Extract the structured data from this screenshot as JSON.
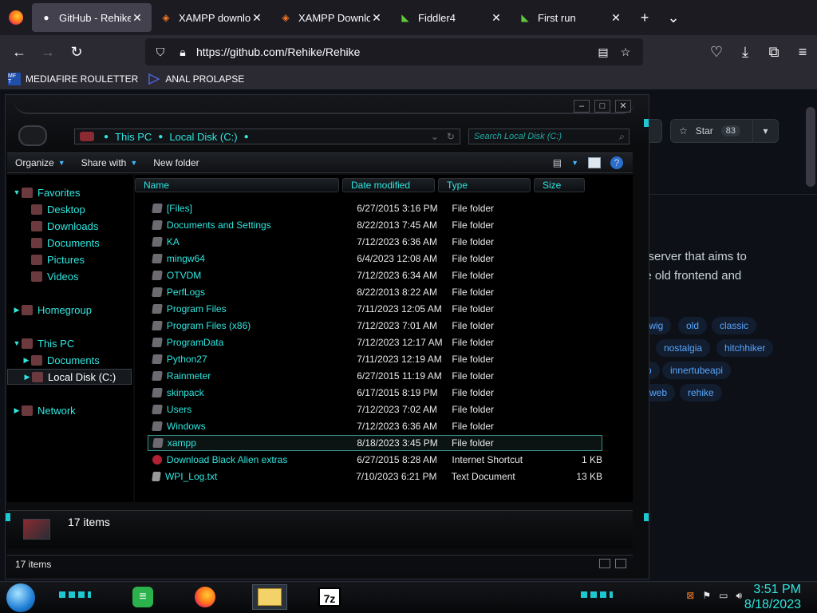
{
  "browser": {
    "tabs": [
      {
        "label": "GitHub - Rehike/R",
        "icon": "github-icon",
        "active": true
      },
      {
        "label": "XAMPP downloa",
        "icon": "xampp-icon",
        "active": false
      },
      {
        "label": "XAMPP Downloa",
        "icon": "xampp-icon",
        "active": false
      },
      {
        "label": "Fiddler4",
        "icon": "fiddler-icon",
        "active": false
      },
      {
        "label": "First run",
        "icon": "fiddler-icon",
        "active": false
      }
    ],
    "url": "https://github.com/Rehike/Rehike",
    "bookmarks": [
      {
        "label": "MEDIAFIRE ROULETTER",
        "icon_text": "MF T"
      },
      {
        "label": "ANAL PROLAPSE",
        "icon_text": ""
      }
    ]
  },
  "github": {
    "star_label": "Star",
    "star_count": "83",
    "description_lines": [
      "e server that aims to",
      "ne old frontend and"
    ],
    "topics": [
      {
        "label": "twig"
      },
      {
        "label": "old"
      },
      {
        "label": "classic"
      },
      {
        "label": "nostalgia"
      },
      {
        "label": "hitchhiker"
      },
      {
        "label": "p"
      },
      {
        "label": "innertubeapi"
      },
      {
        "label": "-web"
      },
      {
        "label": "rehike"
      }
    ]
  },
  "explorer": {
    "address": {
      "crumb1": "This PC",
      "crumb2": "Local Disk (C:)"
    },
    "search_placeholder": "Search Local Disk (C:)",
    "toolbar": {
      "organize": "Organize",
      "share_with": "Share with",
      "new_folder": "New folder"
    },
    "nav": [
      {
        "label": "Favorites",
        "level": 0,
        "arrow": "▼"
      },
      {
        "label": "Desktop",
        "level": 1
      },
      {
        "label": "Downloads",
        "level": 1
      },
      {
        "label": "Documents",
        "level": 1
      },
      {
        "label": "Pictures",
        "level": 1
      },
      {
        "label": "Videos",
        "level": 1
      },
      {
        "label": "Homegroup",
        "level": 0,
        "arrow": "▶"
      },
      {
        "label": "This PC",
        "level": 0,
        "arrow": "▼"
      },
      {
        "label": "Documents",
        "level": 1,
        "arrow": "▶"
      },
      {
        "label": "Local Disk (C:)",
        "level": 1,
        "arrow": "▶",
        "selected": true
      },
      {
        "label": "Network",
        "level": 0,
        "arrow": "▶"
      }
    ],
    "columns": {
      "name": "Name",
      "date": "Date modified",
      "type": "Type",
      "size": "Size"
    },
    "files": [
      {
        "name": "[Files]",
        "date": "6/27/2015 3:16 PM",
        "type": "File folder",
        "size": ""
      },
      {
        "name": "Documents and Settings",
        "date": "8/22/2013 7:45 AM",
        "type": "File folder",
        "size": ""
      },
      {
        "name": "KA",
        "date": "7/12/2023 6:36 AM",
        "type": "File folder",
        "size": ""
      },
      {
        "name": "mingw64",
        "date": "6/4/2023 12:08 AM",
        "type": "File folder",
        "size": ""
      },
      {
        "name": "OTVDM",
        "date": "7/12/2023 6:34 AM",
        "type": "File folder",
        "size": ""
      },
      {
        "name": "PerfLogs",
        "date": "8/22/2013 8:22 AM",
        "type": "File folder",
        "size": ""
      },
      {
        "name": "Program Files",
        "date": "7/11/2023 12:05 AM",
        "type": "File folder",
        "size": ""
      },
      {
        "name": "Program Files (x86)",
        "date": "7/12/2023 7:01 AM",
        "type": "File folder",
        "size": ""
      },
      {
        "name": "ProgramData",
        "date": "7/12/2023 12:17 AM",
        "type": "File folder",
        "size": ""
      },
      {
        "name": "Python27",
        "date": "7/11/2023 12:19 AM",
        "type": "File folder",
        "size": ""
      },
      {
        "name": "Rainmeter",
        "date": "6/27/2015 11:19 AM",
        "type": "File folder",
        "size": ""
      },
      {
        "name": "skinpack",
        "date": "6/17/2015 8:19 PM",
        "type": "File folder",
        "size": ""
      },
      {
        "name": "Users",
        "date": "7/12/2023 7:02 AM",
        "type": "File folder",
        "size": ""
      },
      {
        "name": "Windows",
        "date": "7/12/2023 6:36 AM",
        "type": "File folder",
        "size": ""
      },
      {
        "name": "xampp",
        "date": "8/18/2023 3:45 PM",
        "type": "File folder",
        "size": "",
        "selected": true
      },
      {
        "name": "Download Black Alien extras",
        "date": "6/27/2015 8:28 AM",
        "type": "Internet Shortcut",
        "size": "1 KB",
        "kind": "web"
      },
      {
        "name": "WPI_Log.txt",
        "date": "7/10/2023 6:21 PM",
        "type": "Text Document",
        "size": "13 KB",
        "kind": "txt"
      }
    ],
    "details_text": "17 items",
    "status_text": "17 items"
  },
  "taskbar": {
    "apps": [
      {
        "name": "feedly-icon"
      },
      {
        "name": "firefox-icon"
      },
      {
        "name": "file-explorer-icon",
        "active": true
      },
      {
        "name": "7zip-icon",
        "label": "7z"
      }
    ],
    "time": "3:51 PM",
    "date": "8/18/2023"
  }
}
